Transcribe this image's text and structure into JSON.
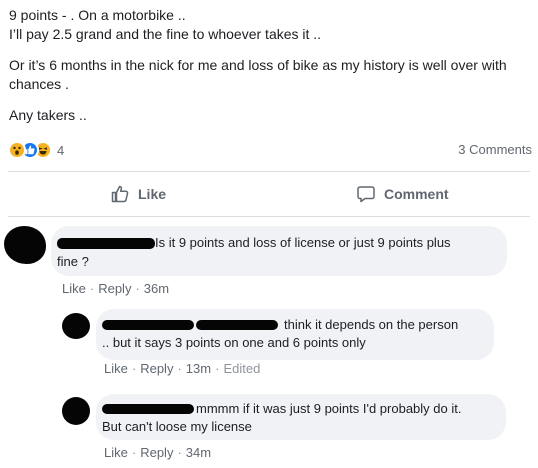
{
  "post": {
    "lines": [
      "9 points - . On a motorbike ..",
      "I’ll pay 2.5 grand and the fine to whoever takes it ..",
      "Or it’s 6 months in the nick for me and loss of bike as my history is well over with chances .",
      "Any takers .."
    ],
    "reactions": {
      "icons": [
        "wow-icon",
        "like-icon",
        "haha-icon"
      ],
      "count": "4"
    },
    "comments_count": "3 Comments"
  },
  "actions": {
    "like_label": "Like",
    "comment_label": "Comment"
  },
  "comments": [
    {
      "text_line1": "Is it 9 points and loss of license or just 9 points plus",
      "text_line2": "fine ?",
      "like": "Like",
      "reply": "Reply",
      "time": "36m"
    },
    {
      "text_line1": "think it depends on the person",
      "text_line2": ".. but it says 3 points on one and 6 points only",
      "like": "Like",
      "reply": "Reply",
      "time": "13m",
      "edited": "Edited"
    },
    {
      "text_line1": "mmmm if it was just 9 points I'd probably do it.",
      "text_line2": "But can't loose my license",
      "like": "Like",
      "reply": "Reply",
      "time": "34m"
    }
  ],
  "colors": {
    "like_blue": "#1877f2",
    "reaction_yellow": "#f7b125",
    "bubble_gray": "#f0f2f5",
    "meta_gray": "#606770"
  }
}
